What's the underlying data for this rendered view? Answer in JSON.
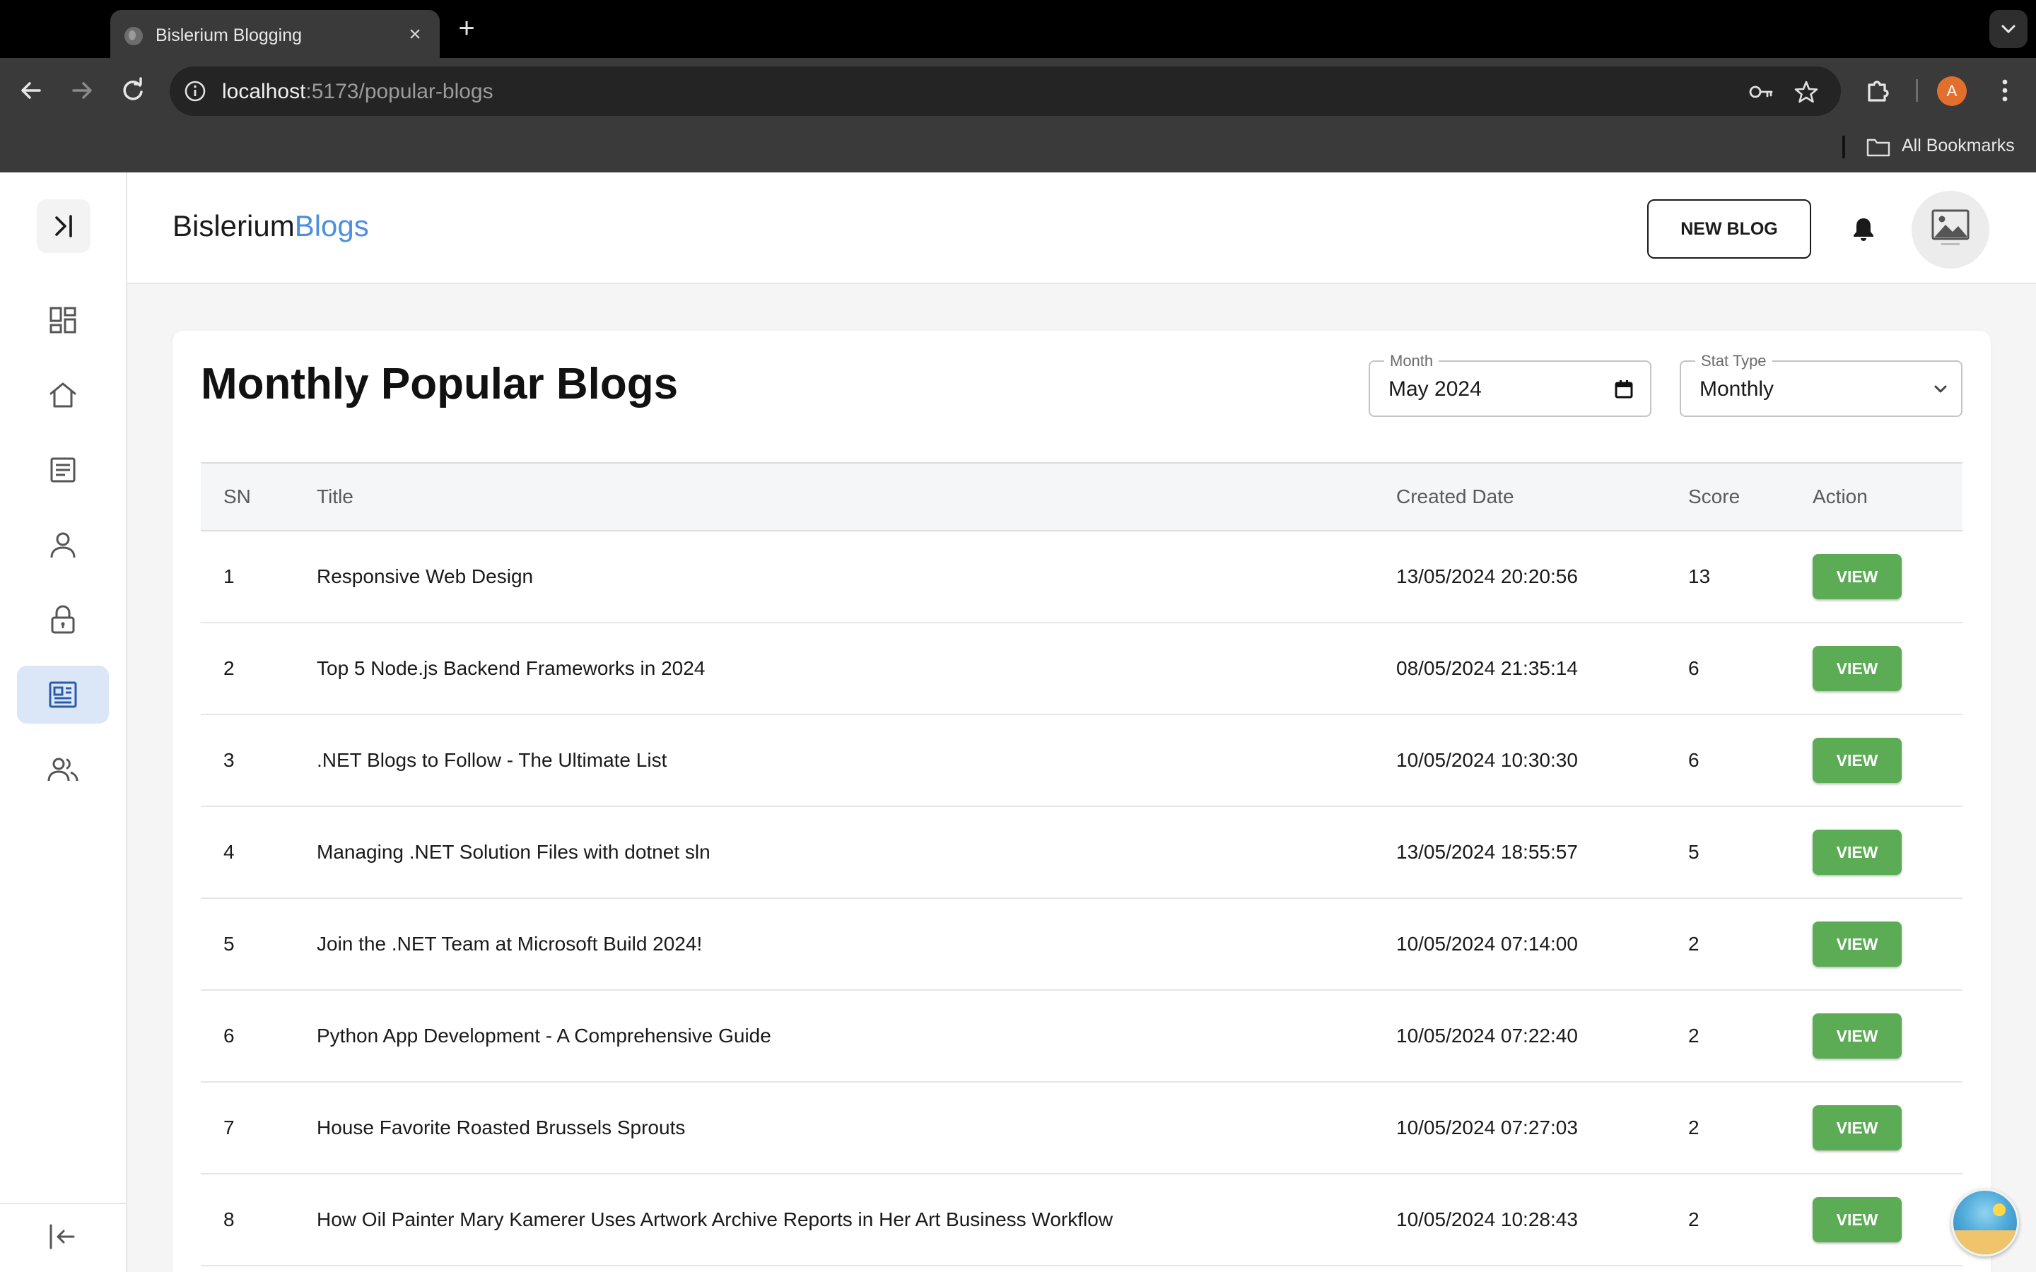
{
  "browser": {
    "tab_title": "Bislerium Blogging",
    "url_host": "localhost",
    "url_path": ":5173/popular-blogs",
    "profile_initial": "A",
    "bookmarks_label": "All Bookmarks"
  },
  "app": {
    "brand_prefix": "Bislerium",
    "brand_accent": "Blogs",
    "new_blog_label": "NEW BLOG",
    "accent_color": "#4a8fe0",
    "view_button_color": "#5cab55"
  },
  "sidebar": {
    "items": [
      {
        "icon": "dashboard-icon",
        "active": false
      },
      {
        "icon": "home-icon",
        "active": false
      },
      {
        "icon": "article-icon",
        "active": false
      },
      {
        "icon": "user-icon",
        "active": false
      },
      {
        "icon": "lock-icon",
        "active": false
      },
      {
        "icon": "newspaper-icon",
        "active": true
      },
      {
        "icon": "users-icon",
        "active": false
      }
    ],
    "bottom_icon": "logout-icon"
  },
  "page": {
    "title": "Monthly Popular Blogs",
    "month_field": {
      "label": "Month",
      "value": "May 2024"
    },
    "stat_field": {
      "label": "Stat Type",
      "value": "Monthly"
    }
  },
  "table": {
    "headers": [
      "SN",
      "Title",
      "Created Date",
      "Score",
      "Action"
    ],
    "rows": [
      {
        "sn": "1",
        "title": "Responsive Web Design",
        "date": "13/05/2024 20:20:56",
        "score": "13",
        "action": "VIEW"
      },
      {
        "sn": "2",
        "title": "Top 5 Node.js Backend Frameworks in 2024",
        "date": "08/05/2024 21:35:14",
        "score": "6",
        "action": "VIEW"
      },
      {
        "sn": "3",
        "title": ".NET Blogs to Follow - The Ultimate List",
        "date": "10/05/2024 10:30:30",
        "score": "6",
        "action": "VIEW"
      },
      {
        "sn": "4",
        "title": "Managing .NET Solution Files with dotnet sln",
        "date": "13/05/2024 18:55:57",
        "score": "5",
        "action": "VIEW"
      },
      {
        "sn": "5",
        "title": "Join the .NET Team at Microsoft Build 2024!",
        "date": "10/05/2024 07:14:00",
        "score": "2",
        "action": "VIEW"
      },
      {
        "sn": "6",
        "title": "Python App Development - A Comprehensive Guide",
        "date": "10/05/2024 07:22:40",
        "score": "2",
        "action": "VIEW"
      },
      {
        "sn": "7",
        "title": "House Favorite Roasted Brussels Sprouts",
        "date": "10/05/2024 07:27:03",
        "score": "2",
        "action": "VIEW"
      },
      {
        "sn": "8",
        "title": "How Oil Painter Mary Kamerer Uses Artwork Archive Reports in Her Art Business Workflow",
        "date": "10/05/2024 10:28:43",
        "score": "2",
        "action": "VIEW"
      }
    ]
  }
}
